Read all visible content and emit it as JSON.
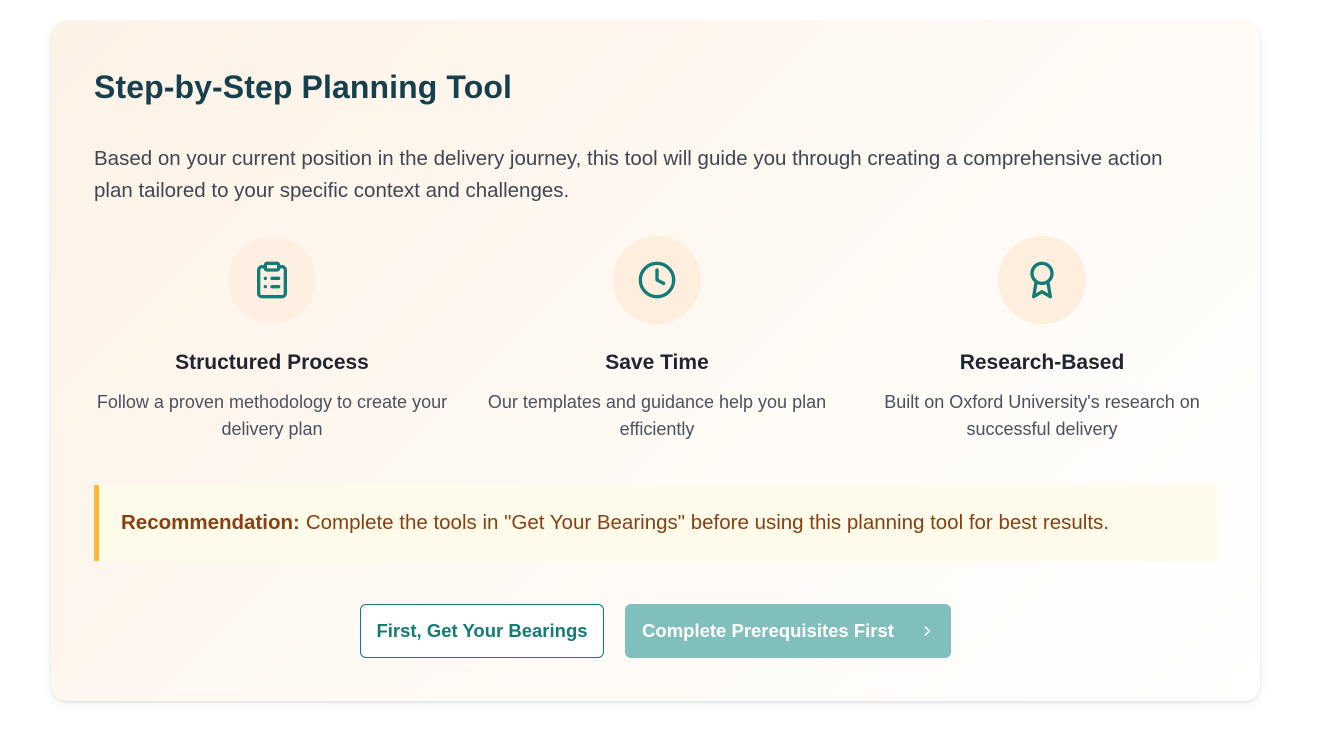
{
  "card": {
    "title": "Step-by-Step Planning Tool",
    "intro": "Based on your current position in the delivery journey, this tool will guide you through creating a comprehensive action plan tailored to your specific context and challenges."
  },
  "features": [
    {
      "icon": "clipboard-list-icon",
      "title": "Structured Process",
      "description": "Follow a proven methodology to create your delivery plan"
    },
    {
      "icon": "clock-icon",
      "title": "Save Time",
      "description": "Our templates and guidance help you plan efficiently"
    },
    {
      "icon": "award-ribbon-icon",
      "title": "Research-Based",
      "description": "Built on Oxford University's research on successful delivery"
    }
  ],
  "recommendation": {
    "label": "Recommendation:",
    "text": "Complete the tools in \"Get Your Bearings\" before using this planning tool for best results."
  },
  "actions": {
    "secondary_label": "First, Get Your Bearings",
    "primary_label": "Complete Prerequisites First",
    "primary_icon": "chevron-right-icon"
  },
  "colors": {
    "heading": "#16404d",
    "accent_teal": "#137b78",
    "disabled_teal": "#80bfbc",
    "recommend_border": "#f7bb35",
    "recommend_text": "#8a3f12",
    "icon_circle": "#fdeedd"
  }
}
